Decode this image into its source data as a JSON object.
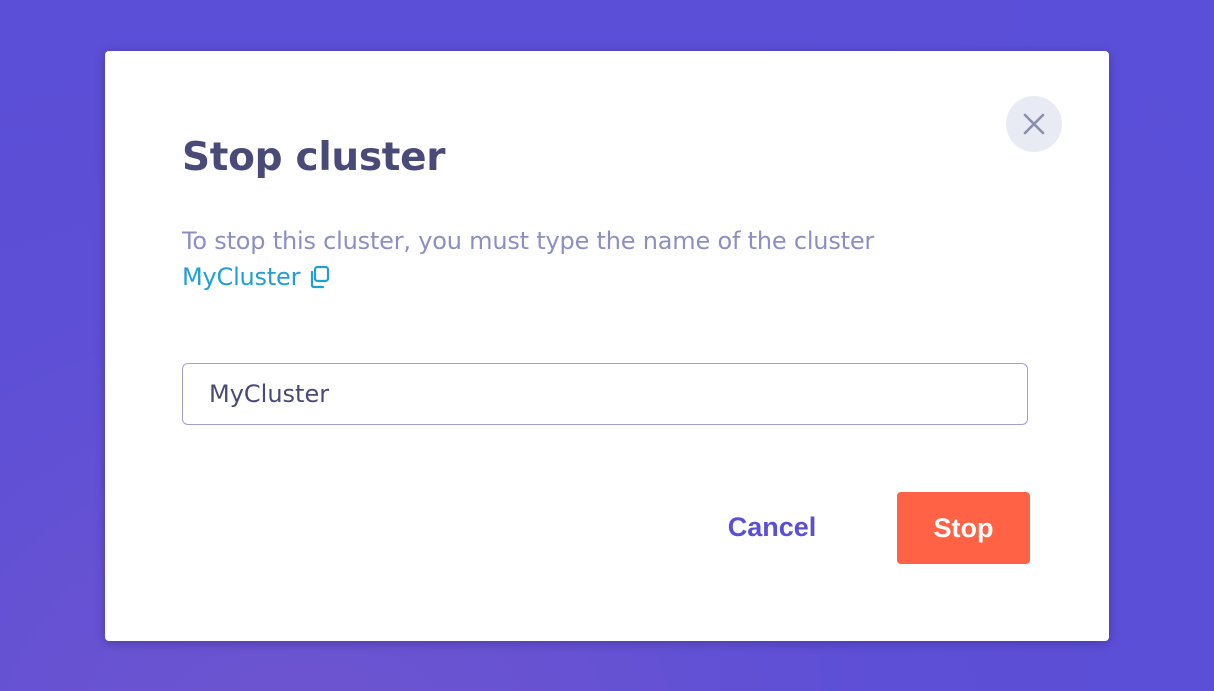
{
  "dialog": {
    "title": "Stop cluster",
    "description": "To stop this cluster, you must type the name of the cluster",
    "cluster_name": "MyCluster",
    "copy_icon": "copy-icon",
    "close_icon": "close-icon",
    "input": {
      "value": "MyCluster",
      "placeholder": ""
    },
    "cancel_label": "Cancel",
    "stop_label": "Stop"
  },
  "colors": {
    "backdrop": "#5d4fd6",
    "title": "#4a4a78",
    "description": "#8d8fc4",
    "link": "#1f9ed8",
    "cancel": "#5b4fd6",
    "stop": "#ff6244",
    "close_bg": "#e8ebf3"
  }
}
